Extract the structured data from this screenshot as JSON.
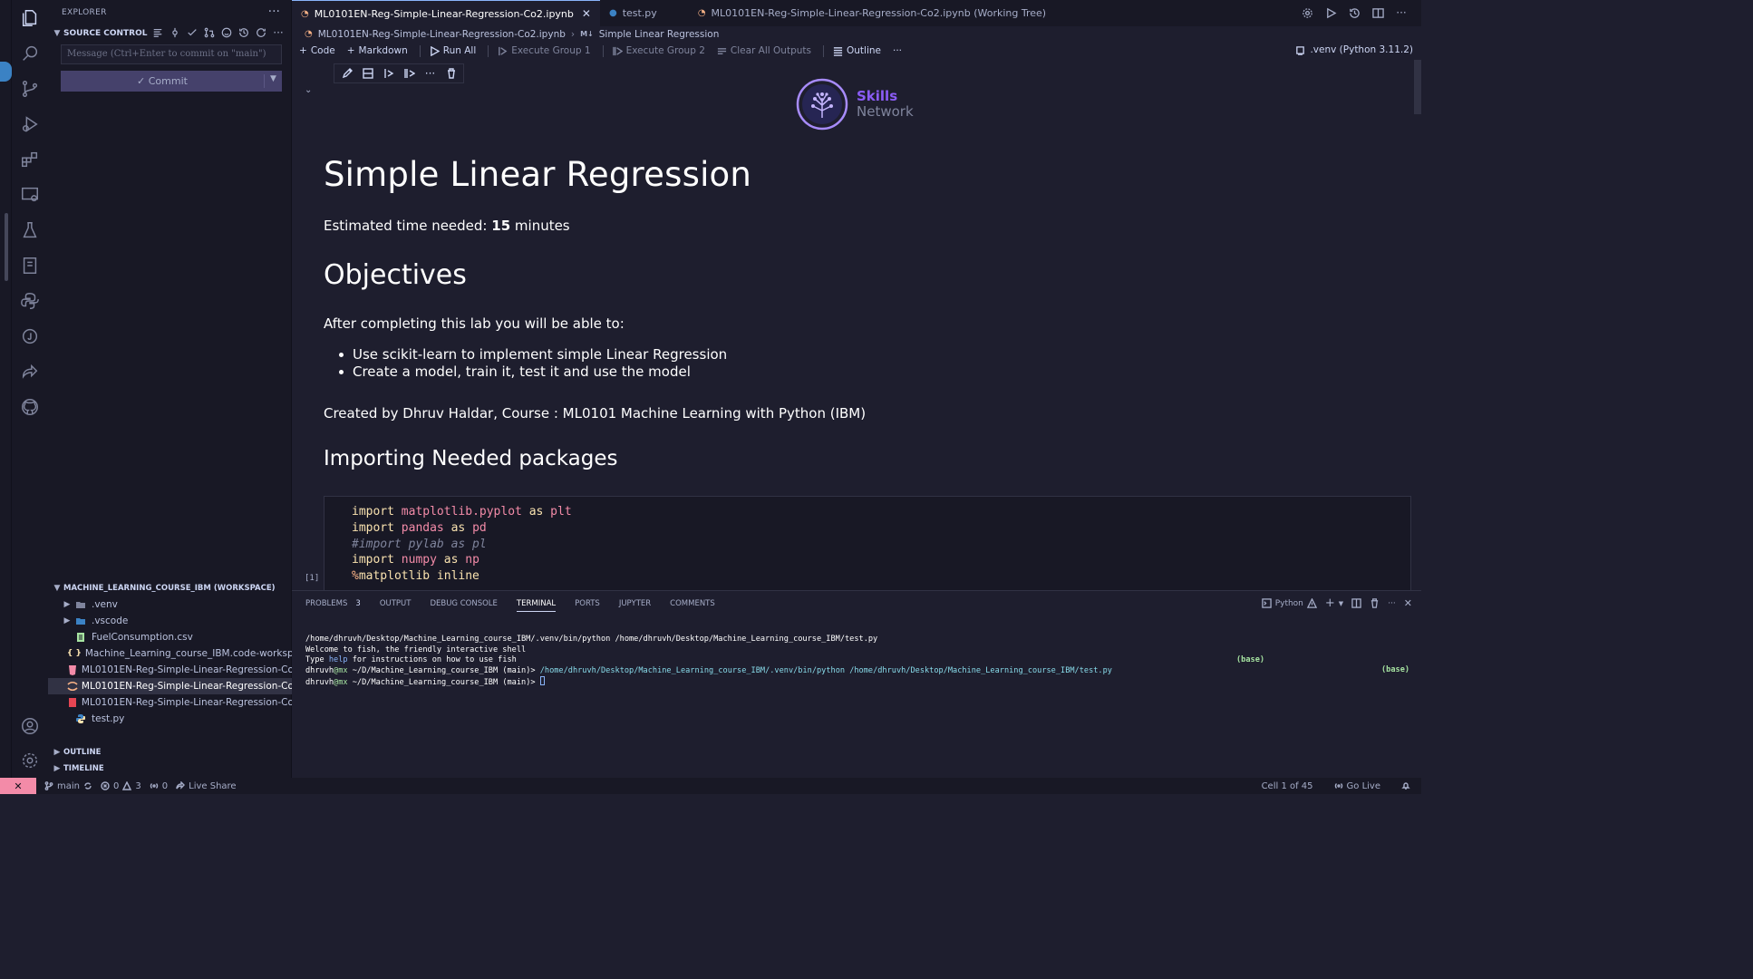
{
  "explorer": {
    "title": "EXPLORER",
    "source_control": {
      "label": "SOURCE CONTROL",
      "message_placeholder": "Message (Ctrl+Enter to commit on \"main\")",
      "commit_label": "Commit"
    },
    "workspace": {
      "label": "MACHINE_LEARNING_COURSE_IBM (WORKSPACE)",
      "items": [
        {
          "name": ".venv",
          "kind": "folder"
        },
        {
          "name": ".vscode",
          "kind": "folder"
        },
        {
          "name": "FuelConsumption.csv",
          "kind": "csv"
        },
        {
          "name": "Machine_Learning_course_IBM.code-worksp...",
          "kind": "workspace"
        },
        {
          "name": "ML0101EN-Reg-Simple-Linear-Regression-Co2...",
          "kind": "html"
        },
        {
          "name": "ML0101EN-Reg-Simple-Linear-Regression-Co2...",
          "kind": "notebook"
        },
        {
          "name": "ML0101EN-Reg-Simple-Linear-Regression-Co2...",
          "kind": "pdf"
        },
        {
          "name": "test.py",
          "kind": "python"
        }
      ]
    },
    "outline_label": "OUTLINE",
    "timeline_label": "TIMELINE"
  },
  "tabs": [
    {
      "label": "ML0101EN-Reg-Simple-Linear-Regression-Co2.ipynb",
      "active": true
    },
    {
      "label": "test.py",
      "active": false
    },
    {
      "label": "ML0101EN-Reg-Simple-Linear-Regression-Co2.ipynb (Working Tree)",
      "active": false
    }
  ],
  "breadcrumb": {
    "file": "ML0101EN-Reg-Simple-Linear-Regression-Co2.ipynb",
    "section": "Simple Linear Regression"
  },
  "toolbar": {
    "code": "Code",
    "markdown": "Markdown",
    "run_all": "Run All",
    "execute_group_1": "Execute Group 1",
    "execute_group_2": "Execute Group 2",
    "clear_outputs": "Clear All Outputs",
    "outline": "Outline",
    "kernel": ".venv (Python 3.11.2)"
  },
  "notebook": {
    "logo_line1": "Skills",
    "logo_line2": "Network",
    "title": "Simple Linear Regression",
    "time_prefix": "Estimated time needed: ",
    "time_value": "15",
    "time_suffix": " minutes",
    "objectives_heading": "Objectives",
    "objectives_intro": "After completing this lab you will be able to:",
    "objectives": [
      "Use scikit-learn to implement simple Linear Regression",
      "Create a model, train it, test it and use the model"
    ],
    "credit": "Created by Dhruv Haldar, Course : ML0101 Machine Learning with Python (IBM)",
    "imports_heading": "Importing Needed packages",
    "exec_count": "[1]",
    "code": {
      "line1": {
        "kw": "import",
        "mod": "matplotlib.pyplot",
        "as": "as",
        "alias": "plt"
      },
      "line2": {
        "kw": "import",
        "mod": "pandas",
        "as": "as",
        "alias": "pd"
      },
      "line3": "#import pylab as pl",
      "line4": {
        "kw": "import",
        "mod": "numpy",
        "as": "as",
        "alias": "np"
      },
      "line5": {
        "magic": "%",
        "text": "matplotlib inline"
      }
    }
  },
  "panel": {
    "tabs": [
      {
        "label": "PROBLEMS",
        "badge": "3"
      },
      {
        "label": "OUTPUT"
      },
      {
        "label": "DEBUG CONSOLE"
      },
      {
        "label": "TERMINAL",
        "active": true
      },
      {
        "label": "PORTS"
      },
      {
        "label": "JUPYTER"
      },
      {
        "label": "COMMENTS"
      }
    ],
    "terminal_profile": "Python",
    "terminal": {
      "line1": "/home/dhruvh/Desktop/Machine_Learning_course_IBM/.venv/bin/python /home/dhruvh/Desktop/Machine_Learning_course_IBM/test.py",
      "line2": "Welcome to fish, the friendly interactive shell",
      "line3_pre": "Type ",
      "line3_help": "help",
      "line3_post": " for instructions on how to use fish",
      "user": "dhruvh",
      "host": "@mx",
      "cwd": " ~/D/Machine_Learning_course_IBM",
      "branch": " (main)> ",
      "cmd": "/home/dhruvh/Desktop/Machine_Learning_course_IBM/.venv/bin/python /home/dhruvh/Desktop/Machine_Learning_course_IBM/test.py",
      "env": "(base)"
    }
  },
  "statusbar": {
    "branch": "main",
    "errors": "0",
    "warnings": "3",
    "ports": "0",
    "live_share": "Live Share",
    "cell": "Cell 1 of 45",
    "go_live": "Go Live"
  }
}
